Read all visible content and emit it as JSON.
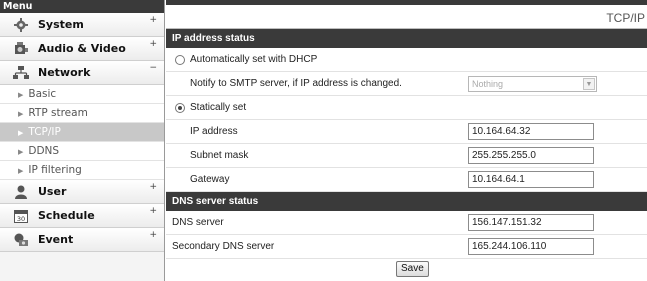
{
  "menu": {
    "title": "Menu"
  },
  "sidebar": {
    "categories": [
      {
        "label": "System",
        "sign": "+"
      },
      {
        "label": "Audio & Video",
        "sign": "+"
      },
      {
        "label": "Network",
        "sign": "−"
      },
      {
        "label": "User",
        "sign": "+"
      },
      {
        "label": "Schedule",
        "sign": "+"
      },
      {
        "label": "Event",
        "sign": "+"
      }
    ],
    "network_items": [
      {
        "label": "Basic"
      },
      {
        "label": "RTP stream"
      },
      {
        "label": "TCP/IP"
      },
      {
        "label": "DDNS"
      },
      {
        "label": "IP filtering"
      }
    ],
    "active_item": "TCP/IP"
  },
  "page": {
    "title": "TCP/IP"
  },
  "ip_section": {
    "header": "IP address status",
    "dhcp_label": "Automatically set with DHCP",
    "dhcp_selected": false,
    "smtp_notify_label": "Notify to SMTP server, if IP address is changed.",
    "smtp_notify_value": "Nothing",
    "static_label": "Statically set",
    "static_selected": true,
    "ip_label": "IP address",
    "ip_value": "10.164.64.32",
    "subnet_label": "Subnet mask",
    "subnet_value": "255.255.255.0",
    "gateway_label": "Gateway",
    "gateway_value": "10.164.64.1"
  },
  "dns_section": {
    "header": "DNS server status",
    "dns_label": "DNS server",
    "dns_value": "156.147.151.32",
    "secondary_label": "Secondary DNS server",
    "secondary_value": "165.244.106.110"
  },
  "actions": {
    "save_label": "Save"
  }
}
